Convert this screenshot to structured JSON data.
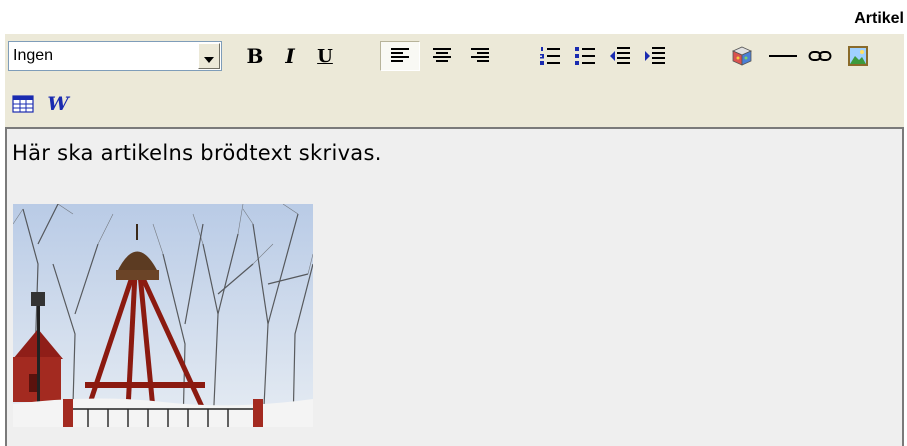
{
  "section_title": "Artikel",
  "toolbar": {
    "format_select": {
      "value": "Ingen"
    },
    "buttons": [
      {
        "name": "bold-button",
        "icon": "bold-icon",
        "glyph": "B"
      },
      {
        "name": "italic-button",
        "icon": "italic-icon",
        "glyph": "I"
      },
      {
        "name": "underline-button",
        "icon": "underline-icon",
        "glyph": "U"
      },
      {
        "name": "align-left-button",
        "icon": "align-left-icon",
        "active": true
      },
      {
        "name": "align-center-button",
        "icon": "align-center-icon"
      },
      {
        "name": "align-right-button",
        "icon": "align-right-icon"
      },
      {
        "name": "numbered-list-button",
        "icon": "numbered-list-icon"
      },
      {
        "name": "bulleted-list-button",
        "icon": "bulleted-list-icon"
      },
      {
        "name": "outdent-button",
        "icon": "outdent-icon"
      },
      {
        "name": "indent-button",
        "icon": "indent-icon"
      },
      {
        "name": "insert-object-button",
        "icon": "cube-object-icon"
      },
      {
        "name": "horizontal-rule-button",
        "icon": "horizontal-rule-icon"
      },
      {
        "name": "insert-link-button",
        "icon": "chain-link-icon"
      },
      {
        "name": "insert-image-button",
        "icon": "image-icon"
      },
      {
        "name": "insert-table-button",
        "icon": "table-icon"
      },
      {
        "name": "paste-from-word-button",
        "icon": "word-icon",
        "glyph": "W"
      }
    ]
  },
  "editor": {
    "body_text": "Här ska artikelns brödtext skrivas."
  },
  "colors": {
    "toolbar_bg": "#ece9d8",
    "editor_bg": "#efefef",
    "link_blue": "#1a2bb0"
  }
}
